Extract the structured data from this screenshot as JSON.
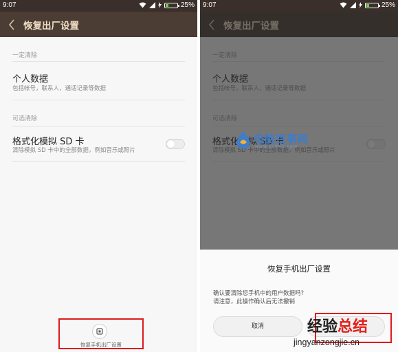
{
  "status": {
    "time": "9:07",
    "battery": "25%",
    "battery_level": 0.25
  },
  "header": {
    "title": "恢复出厂设置"
  },
  "settings": {
    "section_required": "一定清除",
    "personal": {
      "title": "个人数据",
      "subtitle": "包括帐号，联系人，通话记录等数据"
    },
    "section_optional": "可选清除",
    "sdcard": {
      "title": "格式化模拟 SD 卡",
      "subtitle": "清除模拟 SD 卡中的全部数据，例如音乐或照片",
      "enabled": false
    }
  },
  "reset_button": {
    "label": "恢复手机出厂设置"
  },
  "dialog": {
    "title": "恢复手机出厂设置",
    "message_line1": "确认要清除您手机中的用户数据吗?",
    "message_line2": "请注意，此操作确认后无法撤销",
    "cancel_label": "取消"
  },
  "watermark_site": {
    "brand": "电脑百事网",
    "url": "www.pc841.com"
  },
  "watermark_corner": {
    "title_part1": "经验",
    "title_part2": "总结",
    "url": "jingyanzongjie.cn"
  },
  "colors": {
    "header_bg": "#4b3c34",
    "header_text": "#f0dfc5",
    "highlight_red": "#e0191b",
    "battery_green": "#6bd24b"
  }
}
